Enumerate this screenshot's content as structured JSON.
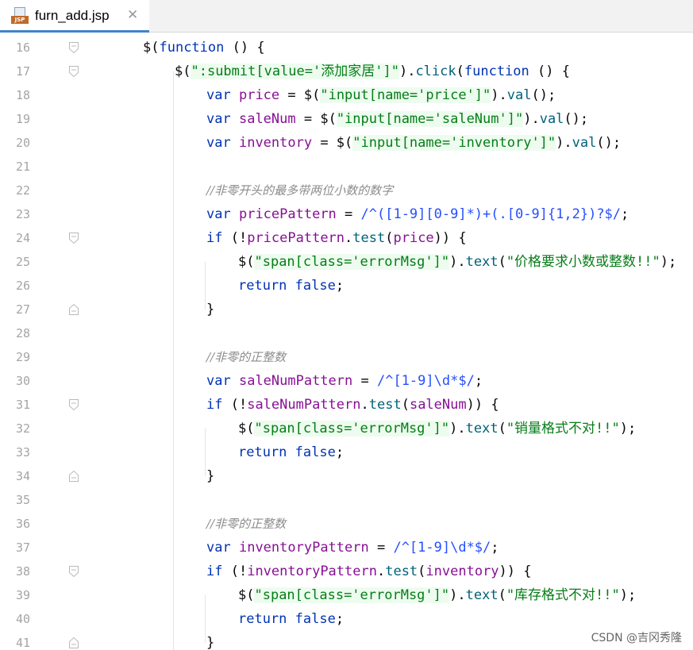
{
  "tab": {
    "label": "furn_add.jsp",
    "icon": "jsp-file-icon",
    "close": "✕"
  },
  "lines": [
    {
      "num": "16",
      "fold": "open"
    },
    {
      "num": "17",
      "fold": "open"
    },
    {
      "num": "18",
      "fold": ""
    },
    {
      "num": "19",
      "fold": ""
    },
    {
      "num": "20",
      "fold": ""
    },
    {
      "num": "21",
      "fold": ""
    },
    {
      "num": "22",
      "fold": ""
    },
    {
      "num": "23",
      "fold": ""
    },
    {
      "num": "24",
      "fold": "open"
    },
    {
      "num": "25",
      "fold": ""
    },
    {
      "num": "26",
      "fold": ""
    },
    {
      "num": "27",
      "fold": "close"
    },
    {
      "num": "28",
      "fold": ""
    },
    {
      "num": "29",
      "fold": ""
    },
    {
      "num": "30",
      "fold": ""
    },
    {
      "num": "31",
      "fold": "open"
    },
    {
      "num": "32",
      "fold": ""
    },
    {
      "num": "33",
      "fold": ""
    },
    {
      "num": "34",
      "fold": "close"
    },
    {
      "num": "35",
      "fold": ""
    },
    {
      "num": "36",
      "fold": ""
    },
    {
      "num": "37",
      "fold": ""
    },
    {
      "num": "38",
      "fold": "open"
    },
    {
      "num": "39",
      "fold": ""
    },
    {
      "num": "40",
      "fold": ""
    },
    {
      "num": "41",
      "fold": "close"
    }
  ],
  "code": {
    "l16": {
      "t1": "$(",
      "t2": "function",
      "t3": " () {"
    },
    "l17": {
      "t1": "$(",
      "t2": "\":submit[value='添加家居']\"",
      "t3": ").",
      "t4": "click",
      "t5": "(",
      "t6": "function",
      "t7": " () {"
    },
    "l18": {
      "t1": "var",
      "t2": " ",
      "t3": "price",
      "t4": " = $(",
      "t5": "\"input[name='price']\"",
      "t6": ").",
      "t7": "val",
      "t8": "();"
    },
    "l19": {
      "t1": "var",
      "t2": " ",
      "t3": "saleNum",
      "t4": " = $(",
      "t5": "\"input[name='saleNum']\"",
      "t6": ").",
      "t7": "val",
      "t8": "();"
    },
    "l20": {
      "t1": "var",
      "t2": " ",
      "t3": "inventory",
      "t4": " = $(",
      "t5": "\"input[name='inventory']\"",
      "t6": ").",
      "t7": "val",
      "t8": "();"
    },
    "l22": {
      "t1": "//非零开头的最多带两位小数的数字"
    },
    "l23": {
      "t1": "var",
      "t2": " ",
      "t3": "pricePattern",
      "t4": " = ",
      "t5": "/^([1-9][0-9]*)+(.[0-9]{1,2})?$/",
      "t6": ";"
    },
    "l24": {
      "t1": "if",
      "t2": " (!",
      "t3": "pricePattern",
      "t4": ".",
      "t5": "test",
      "t6": "(",
      "t7": "price",
      "t8": ")) {"
    },
    "l25": {
      "t1": "$(",
      "t2": "\"span[class='errorMsg']\"",
      "t3": ").",
      "t4": "text",
      "t5": "(",
      "t6": "\"价格要求小数或整数!!\"",
      "t7": ");"
    },
    "l26": {
      "t1": "return",
      "t2": " ",
      "t3": "false",
      "t4": ";"
    },
    "l27": {
      "t1": "}"
    },
    "l29": {
      "t1": "//非零的正整数"
    },
    "l30": {
      "t1": "var",
      "t2": " ",
      "t3": "saleNumPattern",
      "t4": " = ",
      "t5": "/^[1-9]\\d*$/",
      "t6": ";"
    },
    "l31": {
      "t1": "if",
      "t2": " (!",
      "t3": "saleNumPattern",
      "t4": ".",
      "t5": "test",
      "t6": "(",
      "t7": "saleNum",
      "t8": ")) {"
    },
    "l32": {
      "t1": "$(",
      "t2": "\"span[class='errorMsg']\"",
      "t3": ").",
      "t4": "text",
      "t5": "(",
      "t6": "\"销量格式不对!!\"",
      "t7": ");"
    },
    "l33": {
      "t1": "return",
      "t2": " ",
      "t3": "false",
      "t4": ";"
    },
    "l34": {
      "t1": "}"
    },
    "l36": {
      "t1": "//非零的正整数"
    },
    "l37": {
      "t1": "var",
      "t2": " ",
      "t3": "inventoryPattern",
      "t4": " = ",
      "t5": "/^[1-9]\\d*$/",
      "t6": ";"
    },
    "l38": {
      "t1": "if",
      "t2": " (!",
      "t3": "inventoryPattern",
      "t4": ".",
      "t5": "test",
      "t6": "(",
      "t7": "inventory",
      "t8": ")) {"
    },
    "l39": {
      "t1": "$(",
      "t2": "\"span[class='errorMsg']\"",
      "t3": ").",
      "t4": "text",
      "t5": "(",
      "t6": "\"库存格式不对!!\"",
      "t7": ");"
    },
    "l40": {
      "t1": "return",
      "t2": " ",
      "t3": "false",
      "t4": ";"
    },
    "l41": {
      "t1": "}"
    }
  },
  "watermark": "CSDN @吉冈秀隆",
  "colors": {
    "keyword": "#0033b3",
    "string": "#067d17",
    "method": "#00627a",
    "comment": "#8c8c8c",
    "variable": "#871094",
    "tab_accent": "#4083c9"
  }
}
